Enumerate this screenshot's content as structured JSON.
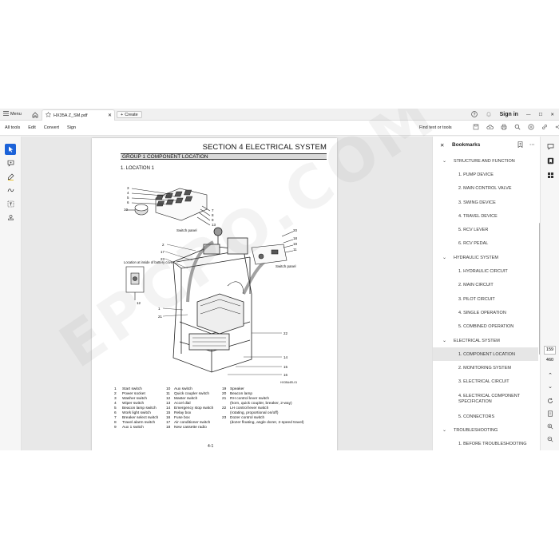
{
  "titlebar": {
    "menu_label": "Menu",
    "tab_title": "HX35A Z_SM.pdf",
    "create_label": "Create",
    "signin_label": "Sign in"
  },
  "toolbar": {
    "menus": [
      "All tools",
      "Edit",
      "Convert",
      "Sign"
    ],
    "find_label": "Find text or tools"
  },
  "document": {
    "section_title": "SECTION  4  ELECTRICAL SYSTEM",
    "group_title": "GROUP  1  COMPONENT LOCATION",
    "location_heading": "1. LOCATION 1",
    "switch_panel_label": "Switch panel",
    "battery_note": "Location at inside of battery cover",
    "drawing_code": "HX35A4EL01",
    "callouts": [
      "3",
      "4",
      "5",
      "6",
      "7",
      "8",
      "9",
      "10",
      "13",
      "2",
      "17",
      "23",
      "1",
      "21",
      "20",
      "18",
      "19",
      "11",
      "12",
      "22",
      "14",
      "15",
      "16"
    ],
    "legend": [
      {
        "n": "1",
        "t": "Start switch"
      },
      {
        "n": "2",
        "t": "Power socket"
      },
      {
        "n": "3",
        "t": "Washer switch"
      },
      {
        "n": "4",
        "t": "Wiper switch"
      },
      {
        "n": "5",
        "t": "Beacon lamp switch"
      },
      {
        "n": "6",
        "t": "Work light switch"
      },
      {
        "n": "7",
        "t": "Breaker select switch"
      },
      {
        "n": "8",
        "t": "Travel alarm switch"
      },
      {
        "n": "9",
        "t": "Aux 1 switch"
      },
      {
        "n": "10",
        "t": "Aux switch"
      },
      {
        "n": "11",
        "t": "Quick coupler switch"
      },
      {
        "n": "12",
        "t": "Master switch"
      },
      {
        "n": "13",
        "t": "Accel dial"
      },
      {
        "n": "14",
        "t": "Emergency stop switch"
      },
      {
        "n": "15",
        "t": "Relay box"
      },
      {
        "n": "16",
        "t": "Fuse box"
      },
      {
        "n": "17",
        "t": "Air conditioner switch"
      },
      {
        "n": "18",
        "t": "New cassette radio"
      },
      {
        "n": "19",
        "t": "Speaker"
      },
      {
        "n": "20",
        "t": "Beacon lamp"
      },
      {
        "n": "21",
        "t": "RH control lever switch"
      },
      {
        "n": "",
        "t": "(horn, quick coupler, breaker, 2-way)"
      },
      {
        "n": "22",
        "t": "LH control lever switch"
      },
      {
        "n": "",
        "t": "(rotating, proportional on/off)"
      },
      {
        "n": "23",
        "t": "Dozer control switch"
      },
      {
        "n": "",
        "t": "(dozer floating, angle dozer, 2-speed travel)"
      }
    ],
    "page_number": "4-1"
  },
  "bookmarks": {
    "title": "Bookmarks",
    "items": [
      {
        "level": 0,
        "label": "STRUCTURE AND FUNCTION"
      },
      {
        "level": 1,
        "label": "1. PUMP DEVICE"
      },
      {
        "level": 1,
        "label": "2. MAIN CONTROL VALVE"
      },
      {
        "level": 1,
        "label": "3. SWING DEVICE"
      },
      {
        "level": 1,
        "label": "4. TRAVEL DEVICE"
      },
      {
        "level": 1,
        "label": "5. RCV LEVER"
      },
      {
        "level": 1,
        "label": "6. RCV PEDAL"
      },
      {
        "level": 0,
        "label": "HYDRAULIC SYSTEM"
      },
      {
        "level": 1,
        "label": "1. HYDRAULIC CIRCUIT"
      },
      {
        "level": 1,
        "label": "2. MAIN CIRCUIT"
      },
      {
        "level": 1,
        "label": "3. PILOT CIRCUIT"
      },
      {
        "level": 1,
        "label": "4. SINGLE OPERATION"
      },
      {
        "level": 1,
        "label": "5. COMBINED OPERATION"
      },
      {
        "level": 0,
        "label": "ELECTRICAL SYSTEM"
      },
      {
        "level": 1,
        "label": "1. COMPONENT LOCATION",
        "selected": true
      },
      {
        "level": 1,
        "label": "2. MONITORING SYSTEM"
      },
      {
        "level": 1,
        "label": "3. ELECTRICAL CIRCUIT"
      },
      {
        "level": 1,
        "label": "4. ELECTRICAL COMPONENT SPECIFICATION",
        "two_line": true
      },
      {
        "level": 1,
        "label": "5. CONNECTORS"
      },
      {
        "level": 0,
        "label": "TROUBLESHOOTING"
      },
      {
        "level": 1,
        "label": "1. BEFORE TROUBLESHOOTING"
      }
    ]
  },
  "pager": {
    "current_page": "159",
    "total_pages": "460"
  },
  "watermark": "EPCPO.COM",
  "colors": {
    "accent": "#1b62d8",
    "selected_bookmark_bg": "#e6e6e6"
  }
}
